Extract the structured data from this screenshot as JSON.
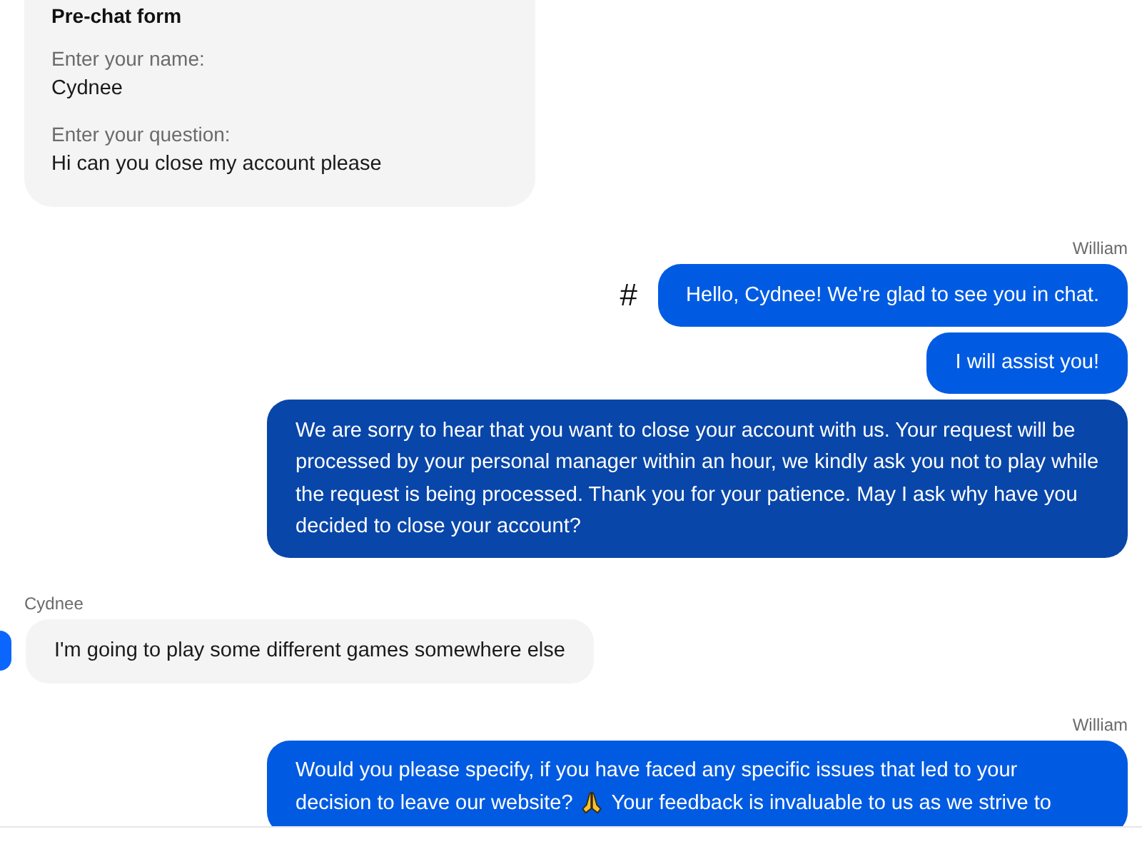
{
  "prechat_form": {
    "title": "Pre-chat form",
    "fields": [
      {
        "label": "Enter your name:",
        "value": "Cydnee"
      },
      {
        "label": "Enter your question:",
        "value": "Hi can you close my account please"
      }
    ]
  },
  "messages": [
    {
      "kind": "agent",
      "sender": "William",
      "bubbles": [
        {
          "marker": "#",
          "text": "Hello, Cydnee! We're glad to see you in chat.",
          "highlighted": false
        },
        {
          "text": "I will assist you!",
          "highlighted": false
        },
        {
          "text": "We are sorry to hear that you want to close your account with us. Your request will be processed by your personal manager within an hour, we kindly ask you not to play while the request is being processed. Thank you for your patience. May I ask why have you decided to close your account?",
          "highlighted": true
        }
      ]
    },
    {
      "kind": "customer",
      "sender": "Cydnee",
      "bubbles": [
        {
          "text": "I'm going to play some different games somewhere else"
        }
      ]
    },
    {
      "kind": "agent",
      "sender": "William",
      "bubbles": [
        {
          "lines": [
            [
              {
                "kind": "text",
                "text": "Would you please specify, if you have faced any specific issues that led to your"
              }
            ],
            [
              {
                "kind": "text",
                "text": "decision to leave our website?"
              },
              {
                "kind": "praying-hands"
              },
              {
                "kind": "text",
                "text": "Your feedback is invaluable to us as we strive to"
              }
            ]
          ],
          "highlighted": false
        }
      ]
    }
  ]
}
